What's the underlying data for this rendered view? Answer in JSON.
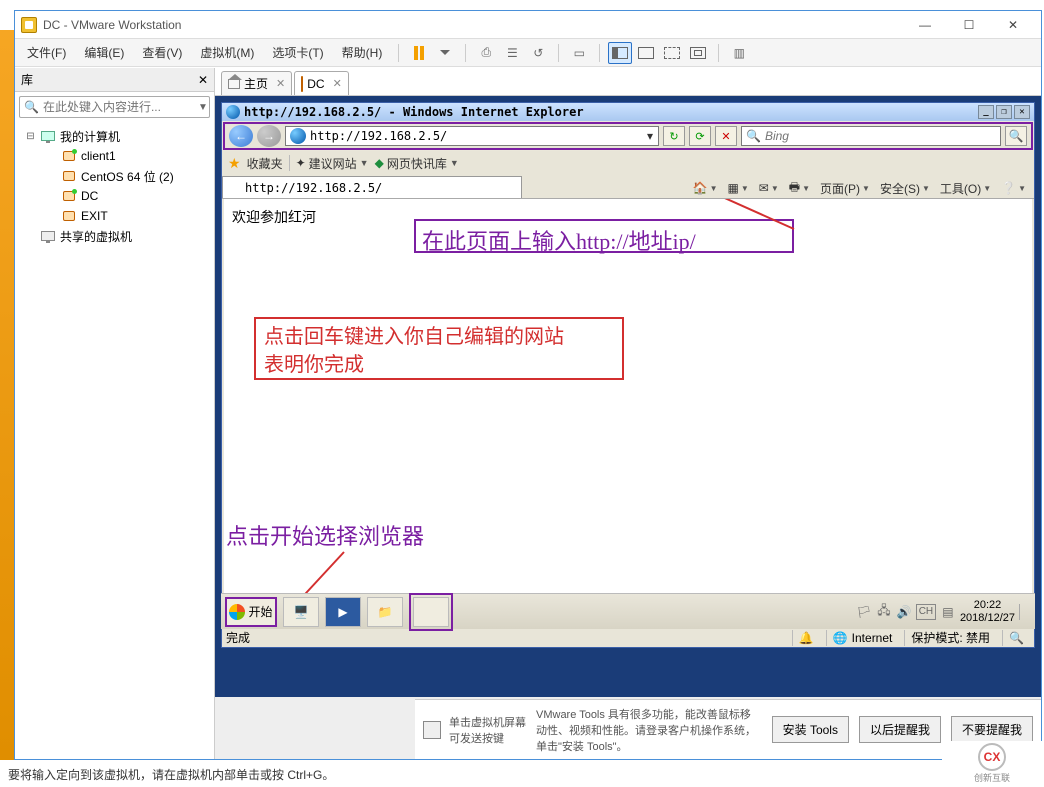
{
  "window": {
    "title": "DC - VMware Workstation",
    "minimize": "—",
    "maximize": "☐",
    "close": "✕"
  },
  "menus": {
    "file": "文件(F)",
    "edit": "编辑(E)",
    "view": "查看(V)",
    "vm": "虚拟机(M)",
    "tabs": "选项卡(T)",
    "help": "帮助(H)"
  },
  "library": {
    "title": "库",
    "search_placeholder": "在此处键入内容进行...",
    "tree": {
      "root": "我的计算机",
      "items": [
        "client1",
        "CentOS 64 位 (2)",
        "DC",
        "EXIT"
      ],
      "shared": "共享的虚拟机"
    }
  },
  "tabs": {
    "home": "主页",
    "dc": "DC"
  },
  "ie": {
    "title_text": "http://192.168.2.5/ - Windows Internet Explorer",
    "url": "http://192.168.2.5/",
    "search_placeholder": "Bing",
    "favorites_label": "收藏夹",
    "suggested": "建议网站",
    "webslice": "网页快讯库",
    "tab_url": "http://192.168.2.5/",
    "toolbar": {
      "page": "页面(P)",
      "safety": "安全(S)",
      "tools": "工具(O)"
    },
    "content": "欢迎参加红河",
    "status_done": "完成",
    "status_zone": "Internet",
    "status_mode": "保护模式: 禁用"
  },
  "annotations": {
    "anno1": "在此页面上输入http://地址ip/",
    "anno2_line1": "点击回车键进入你自己编辑的网站",
    "anno2_line2": "表明你完成",
    "anno3": "点击开始选择浏览器"
  },
  "taskbar": {
    "start": "开始",
    "lang": "CH",
    "time": "20:22",
    "date": "2018/12/27"
  },
  "vmware_footer": {
    "hint1": "单击虚拟机屏幕",
    "hint2": "可发送按键",
    "msg": "VMware Tools 具有很多功能，能改善鼠标移动性、视频和性能。请登录客户机操作系统，单击\"安装 Tools\"。",
    "install": "安装 Tools",
    "later": "以后提醒我",
    "never": "不要提醒我"
  },
  "status_bar": "要将输入定向到该虚拟机，请在虚拟机内部单击或按 Ctrl+G。",
  "watermark": "创新互联"
}
